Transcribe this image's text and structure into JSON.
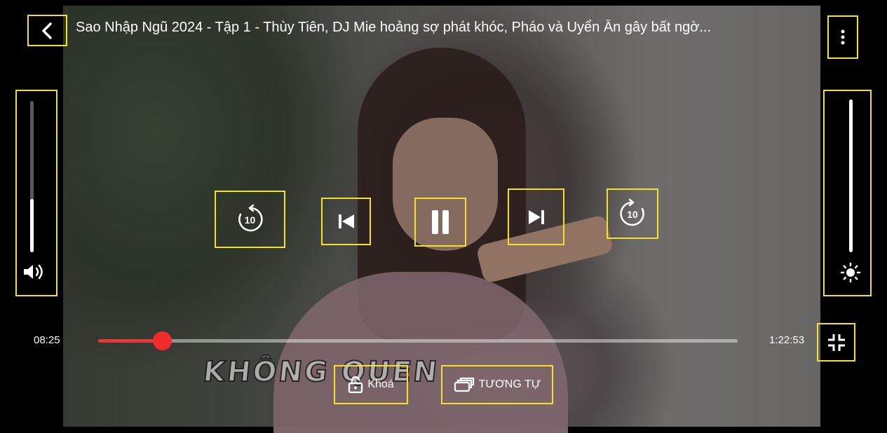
{
  "header": {
    "title": "Sao Nhập Ngũ 2024 - Tập 1 - Thùy Tiên, DJ Mie hoảng sợ phát khóc, Pháo và Uyển Ân gây bất ngờ...",
    "back_icon": "chevron-left-icon",
    "menu_icon": "more-vertical-icon"
  },
  "video": {
    "overlay_text": "KHÔNG QUEN"
  },
  "volume": {
    "level": 0.35,
    "icon": "volume-icon"
  },
  "brightness": {
    "level": 1.0,
    "icon": "brightness-icon"
  },
  "controls": {
    "rewind_label": "10",
    "forward_label": "10",
    "rewind_icon": "replay-10-icon",
    "previous_icon": "skip-previous-icon",
    "pause_icon": "pause-icon",
    "next_icon": "skip-next-icon",
    "forward_icon": "forward-10-icon"
  },
  "progress": {
    "current_time": "08:25",
    "total_time": "1:22:53",
    "fraction": 0.1
  },
  "bottom": {
    "lock_label": "Khoá",
    "similar_label": "TƯƠNG TỰ",
    "lock_icon": "unlock-icon",
    "similar_icon": "playlist-icon",
    "fullscreen_exit_icon": "fullscreen-exit-icon"
  },
  "colors": {
    "highlight": "#f4e22a",
    "progress": "#e53935"
  }
}
